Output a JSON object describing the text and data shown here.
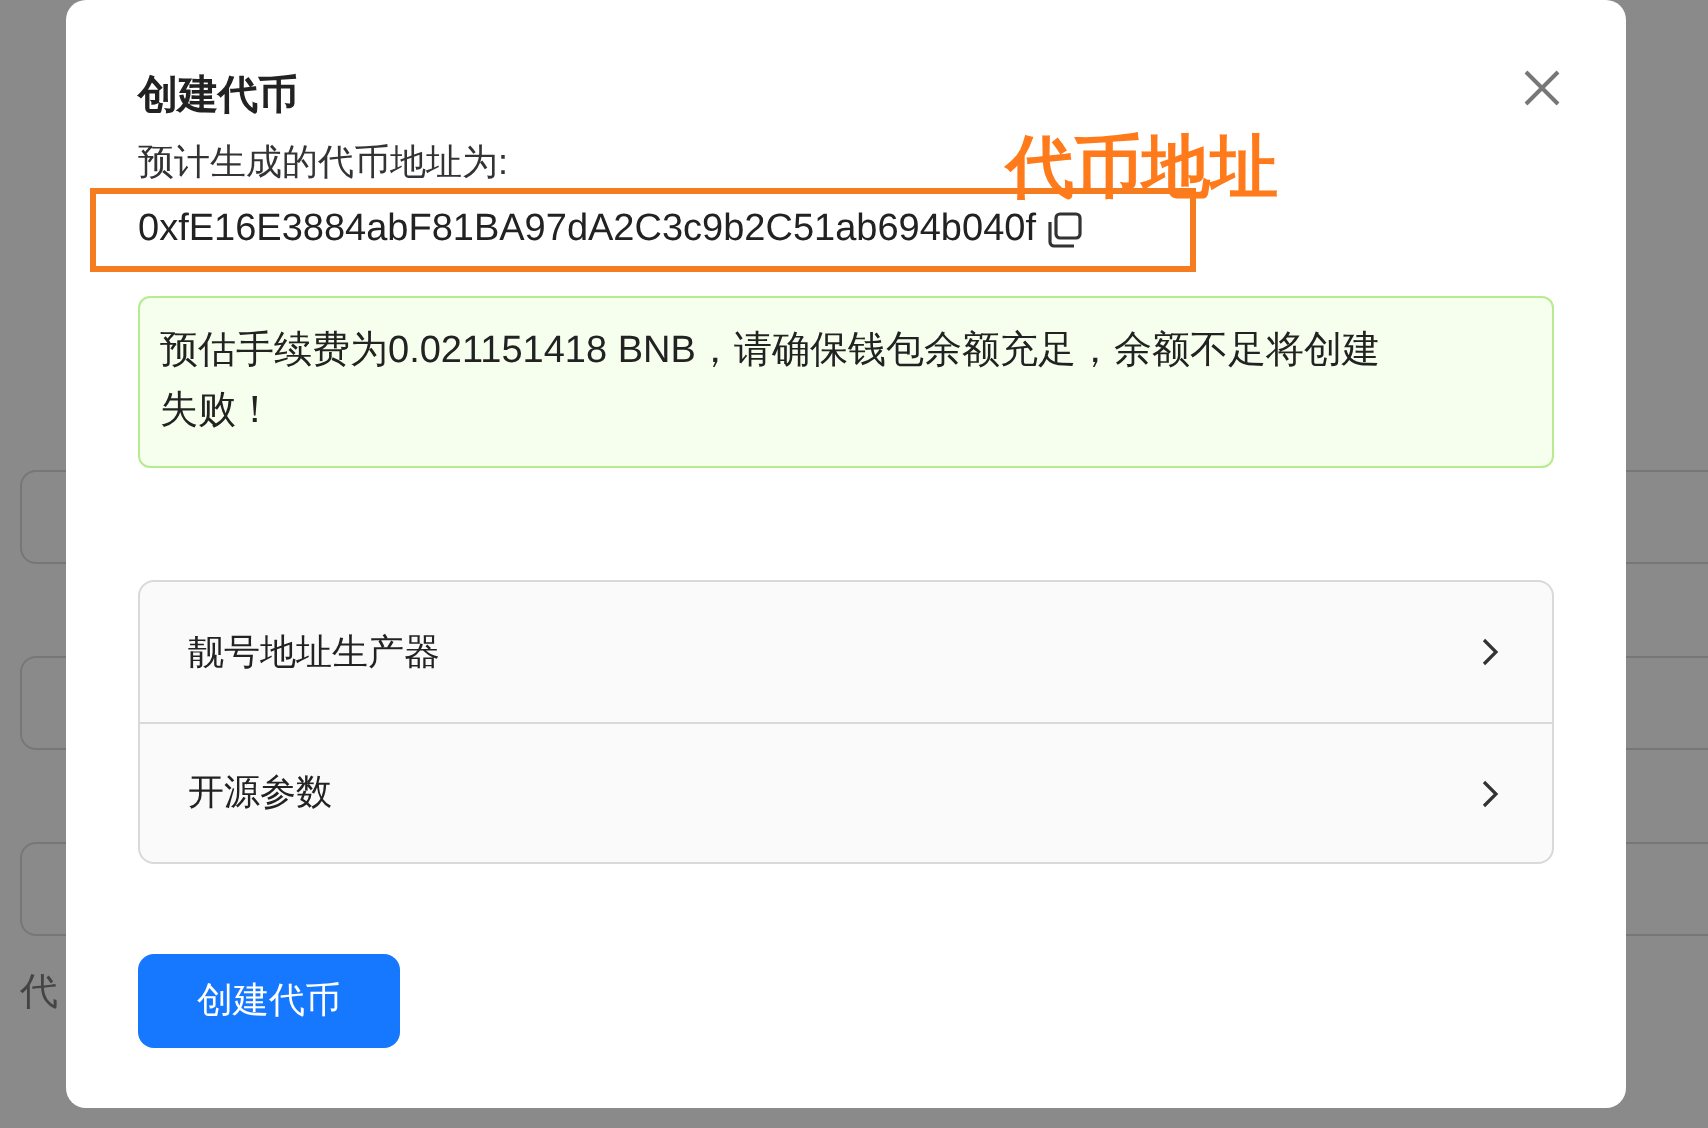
{
  "background": {
    "label": "代"
  },
  "dialog": {
    "title": "创建代币",
    "address_label": "预计生成的代币地址为:",
    "address": "0xfE16E3884abF81BA97dA2C3c9b2C51ab694b040f",
    "annotation": "代币地址",
    "alert": "预估手续费为0.021151418 BNB，请确保钱包余额充足，余额不足将创建失败！",
    "panels": [
      {
        "label": "靓号地址生产器",
        "expanded": false
      },
      {
        "label": "开源参数",
        "expanded": false
      }
    ],
    "submit": "创建代币"
  }
}
